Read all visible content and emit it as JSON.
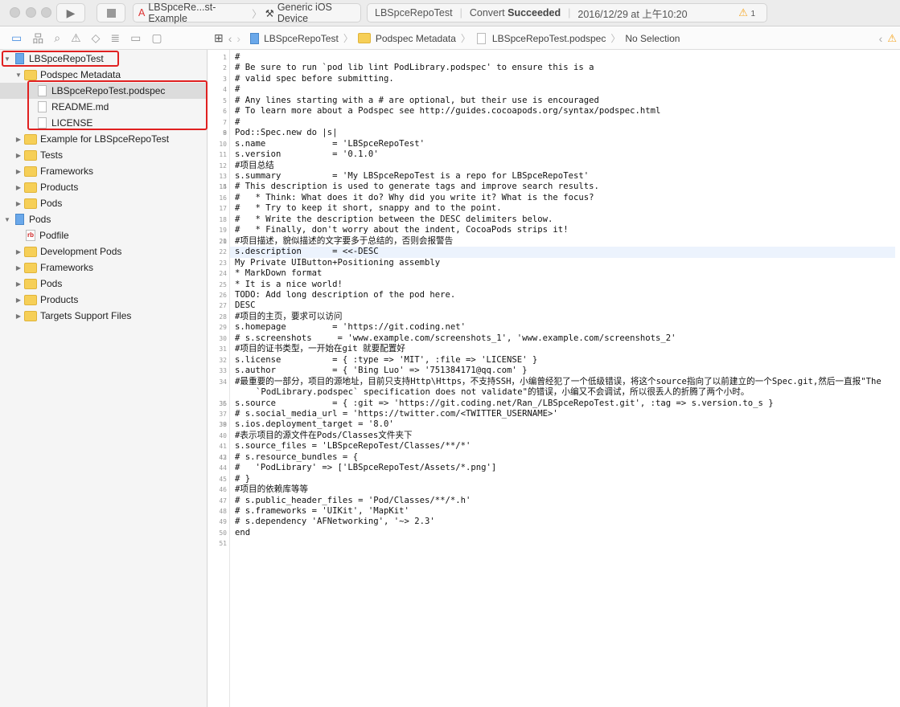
{
  "toolbar": {
    "scheme": "LBSpceRe...st-Example",
    "device": "Generic iOS Device",
    "project": "LBSpceRepoTest",
    "status_prefix": "Convert",
    "status_result": "Succeeded",
    "timestamp": "2016/12/29 at 上午10:20",
    "warning_count": "1"
  },
  "navigator_icons": [
    "folder-icon",
    "hierarchy-icon",
    "search-icon",
    "warning-icon",
    "test-icon",
    "debug-icon",
    "breakpoint-icon",
    "report-icon"
  ],
  "sidebar": {
    "items": [
      {
        "label": "LBSpceRepoTest",
        "level": 0,
        "type": "project",
        "expanded": true
      },
      {
        "label": "Podspec Metadata",
        "level": 1,
        "type": "folder",
        "expanded": true
      },
      {
        "label": "LBSpceRepoTest.podspec",
        "level": 2,
        "type": "file",
        "selected": true
      },
      {
        "label": "README.md",
        "level": 2,
        "type": "file"
      },
      {
        "label": "LICENSE",
        "level": 2,
        "type": "file"
      },
      {
        "label": "Example for LBSpceRepoTest",
        "level": 1,
        "type": "folder",
        "expanded": false
      },
      {
        "label": "Tests",
        "level": 1,
        "type": "folder",
        "expanded": false
      },
      {
        "label": "Frameworks",
        "level": 1,
        "type": "folder",
        "expanded": false
      },
      {
        "label": "Products",
        "level": 1,
        "type": "folder",
        "expanded": false
      },
      {
        "label": "Pods",
        "level": 1,
        "type": "folder",
        "expanded": false
      },
      {
        "label": "Pods",
        "level": 0,
        "type": "project",
        "expanded": true
      },
      {
        "label": "Podfile",
        "level": 1,
        "type": "ruby"
      },
      {
        "label": "Development Pods",
        "level": 1,
        "type": "folder",
        "expanded": false
      },
      {
        "label": "Frameworks",
        "level": 1,
        "type": "folder",
        "expanded": false
      },
      {
        "label": "Pods",
        "level": 1,
        "type": "folder",
        "expanded": false
      },
      {
        "label": "Products",
        "level": 1,
        "type": "folder",
        "expanded": false
      },
      {
        "label": "Targets Support Files",
        "level": 1,
        "type": "folder",
        "expanded": false
      }
    ]
  },
  "jumpbar": [
    "LBSpceRepoTest",
    "Podspec Metadata",
    "LBSpceRepoTest.podspec",
    "No Selection"
  ],
  "editor": {
    "current_line": 22,
    "lines": [
      "#",
      "# Be sure to run `pod lib lint PodLibrary.podspec' to ensure this is a",
      "# valid spec before submitting.",
      "#",
      "# Any lines starting with a # are optional, but their use is encouraged",
      "# To learn more about a Podspec see http://guides.cocoapods.org/syntax/podspec.html",
      "#",
      "",
      "Pod::Spec.new do |s|",
      "s.name             = 'LBSpceRepoTest'",
      "s.version          = '0.1.0'",
      "#项目总结",
      "s.summary          = 'My LBSpceRepoTest is a repo for LBSpceRepoTest'",
      "",
      "# This description is used to generate tags and improve search results.",
      "#   * Think: What does it do? Why did you write it? What is the focus?",
      "#   * Try to keep it short, snappy and to the point.",
      "#   * Write the description between the DESC delimiters below.",
      "#   * Finally, don't worry about the indent, CocoaPods strips it!",
      "",
      "#项目描述，貌似描述的文字要多于总结的，否则会报警告",
      "s.description      = <<-DESC",
      "My Private UIButton+Positioning assembly",
      "* MarkDown format",
      "* It is a nice world!",
      "TODO: Add long description of the pod here.",
      "DESC",
      "#项目的主页，要求可以访问",
      "s.homepage         = 'https://git.coding.net'",
      "# s.screenshots     = 'www.example.com/screenshots_1', 'www.example.com/screenshots_2'",
      "#项目的证书类型，一开始在git 就要配置好",
      "s.license          = { :type => 'MIT', :file => 'LICENSE' }",
      "s.author           = { 'Bing Luo' => '751384171@qq.com' }",
      "#最重要的一部分，项目的源地址，目前只支持Http\\Https，不支持SSH，小编曾经犯了一个低级错误，将这个source指向了以前建立的一个Spec.git,然后一直报\"The `PodLibrary.podspec` specification does not validate\"的错误，小编又不会调试，所以很丢人的折腾了两个小时。",
      "",
      "s.source           = { :git => 'https://git.coding.net/Ran_/LBSpceRepoTest.git', :tag => s.version.to_s }",
      "# s.social_media_url = 'https://twitter.com/<TWITTER_USERNAME>'",
      "",
      "s.ios.deployment_target = '8.0'",
      "#表示项目的源文件在Pods/Classes文件夹下",
      "s.source_files = 'LBSpceRepoTest/Classes/**/*'",
      "",
      "# s.resource_bundles = {",
      "#   'PodLibrary' => ['LBSpceRepoTest/Assets/*.png']",
      "# }",
      "#项目的依赖库等等",
      "# s.public_header_files = 'Pod/Classes/**/*.h'",
      "# s.frameworks = 'UIKit', 'MapKit'",
      "# s.dependency 'AFNetworking', '~> 2.3'",
      "end",
      ""
    ]
  }
}
